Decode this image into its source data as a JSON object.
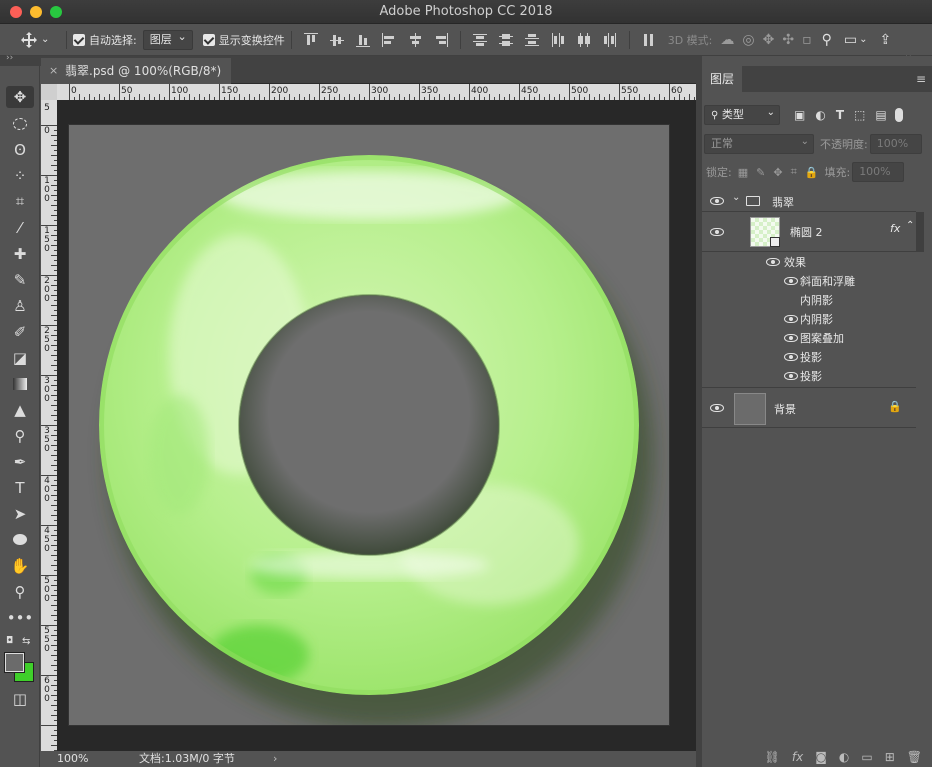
{
  "window": {
    "title": "Adobe Photoshop CC 2018"
  },
  "options_bar": {
    "auto_select_label": "自动选择:",
    "auto_select_value": "图层",
    "show_transform_label": "显示变换控件",
    "mode_3d_label": "3D 模式:"
  },
  "document": {
    "tab_title": "翡翠.psd @ 100%(RGB/8*)",
    "zoom": "100%",
    "doc_info": "文档:1.03M/0 字节",
    "ruler_h_labels": [
      "0",
      "50",
      "100",
      "150",
      "200",
      "250",
      "300",
      "350",
      "400",
      "450",
      "500",
      "550",
      "60"
    ],
    "ruler_v_labels": [
      "5",
      "0",
      "1\n0\n0",
      "1\n5\n0",
      "2\n0\n0",
      "2\n5\n0",
      "3\n0\n0",
      "3\n5\n0",
      "4\n0\n0",
      "4\n5\n0",
      "5\n0\n0",
      "5\n5\n0",
      "6\n0\n0"
    ]
  },
  "layers_panel": {
    "tab": "图层",
    "filter_label": "类型",
    "blend_mode": "正常",
    "opacity_label": "不透明度:",
    "opacity_value": "100%",
    "lock_label": "锁定:",
    "fill_label": "填充:",
    "fill_value": "100%",
    "group_name": "翡翠",
    "layer_ellipse": "椭圆 2",
    "fx_badge": "fx",
    "effects_label": "效果",
    "effects": [
      {
        "name": "斜面和浮雕",
        "visible": true
      },
      {
        "name": "内阴影",
        "visible": false
      },
      {
        "name": "内阴影",
        "visible": true
      },
      {
        "name": "图案叠加",
        "visible": true
      },
      {
        "name": "投影",
        "visible": true
      },
      {
        "name": "投影",
        "visible": true
      }
    ],
    "background_layer": "背景"
  },
  "colors": {
    "foreground": "#6b6b6b",
    "background": "#3fcf2a",
    "jade_light": "#d8f7b8",
    "jade_mid": "#a8ea7a",
    "jade_dark": "#5fd43a"
  }
}
